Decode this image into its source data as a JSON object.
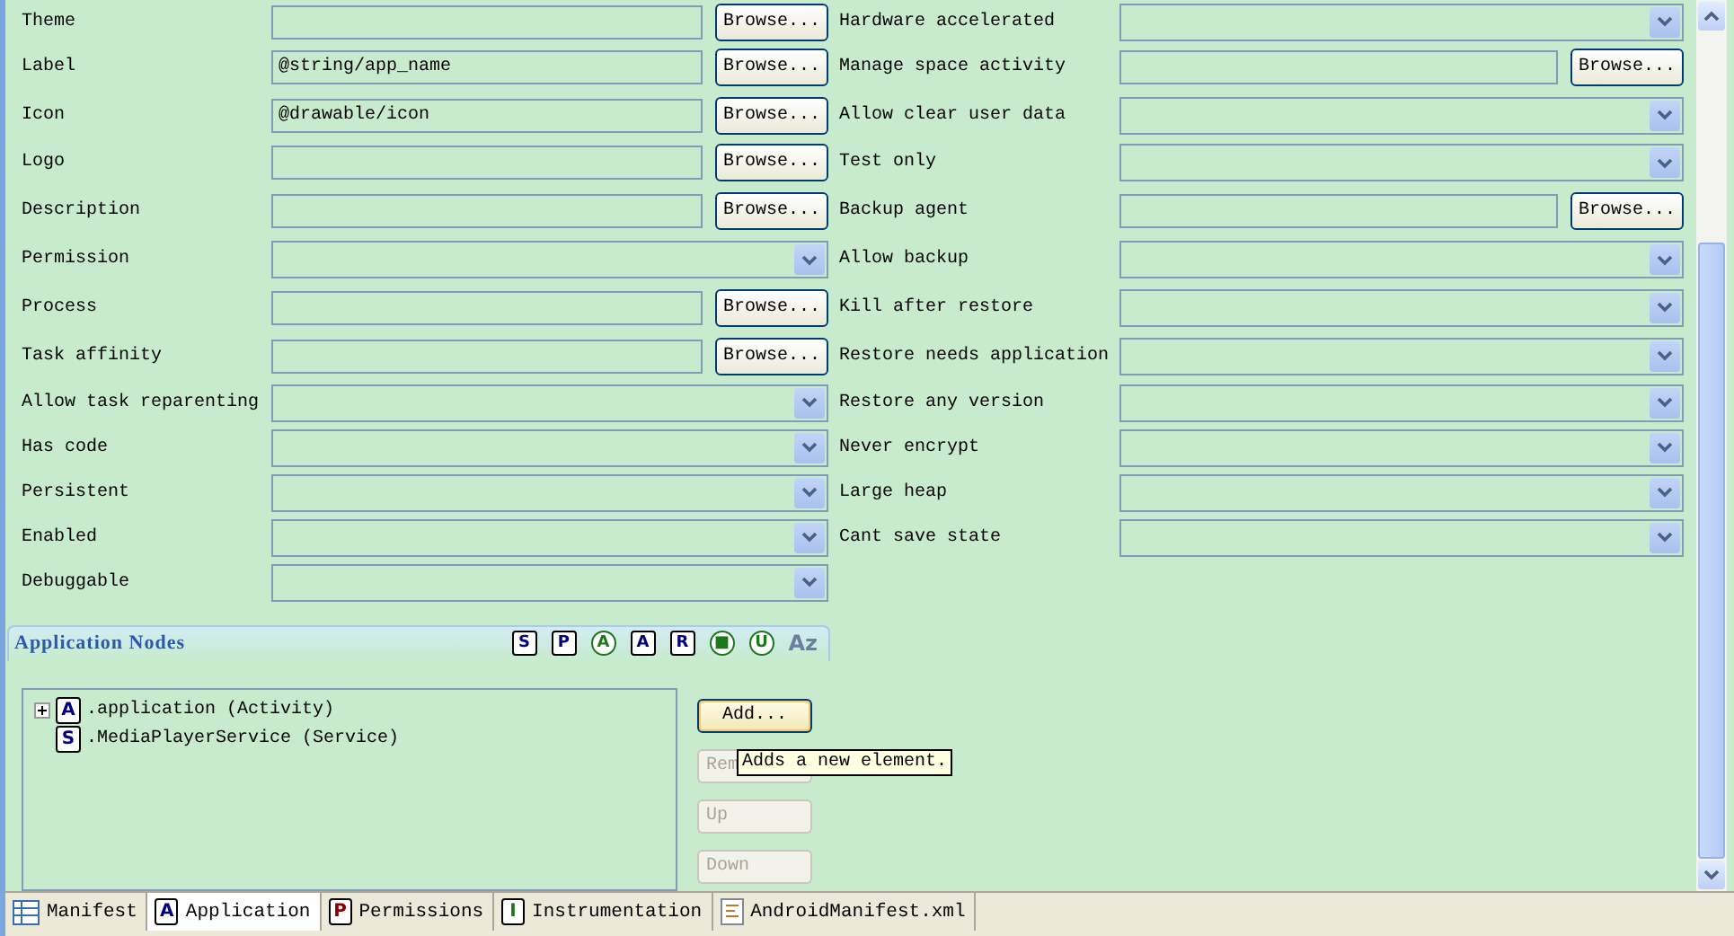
{
  "left_fields": [
    {
      "label": "Theme",
      "kind": "text",
      "browse": "Browse..."
    },
    {
      "label": "Label",
      "kind": "text",
      "value": "@string/app_name",
      "browse": "Browse..."
    },
    {
      "label": "Icon",
      "kind": "text",
      "value": "@drawable/icon",
      "browse": "Browse..."
    },
    {
      "label": "Logo",
      "kind": "text",
      "browse": "Browse..."
    },
    {
      "label": "Description",
      "kind": "text",
      "browse": "Browse..."
    },
    {
      "label": "Permission",
      "kind": "combo"
    },
    {
      "label": "Process",
      "kind": "text",
      "browse": "Browse..."
    },
    {
      "label": "Task affinity",
      "kind": "text",
      "browse": "Browse..."
    },
    {
      "label": "Allow task reparenting",
      "kind": "combo"
    },
    {
      "label": "Has code",
      "kind": "combo"
    },
    {
      "label": "Persistent",
      "kind": "combo"
    },
    {
      "label": "Enabled",
      "kind": "combo"
    },
    {
      "label": "Debuggable",
      "kind": "combo"
    }
  ],
  "right_fields": [
    {
      "label": "Hardware accelerated",
      "kind": "combo"
    },
    {
      "label": "Manage space activity",
      "kind": "text",
      "browse": "Browse..."
    },
    {
      "label": "Allow clear user data",
      "kind": "combo"
    },
    {
      "label": "Test only",
      "kind": "combo"
    },
    {
      "label": "Backup agent",
      "kind": "text",
      "browse": "Browse..."
    },
    {
      "label": "Allow backup",
      "kind": "combo"
    },
    {
      "label": "Kill after restore",
      "kind": "combo"
    },
    {
      "label": "Restore needs application",
      "kind": "combo"
    },
    {
      "label": "Restore any version",
      "kind": "combo"
    },
    {
      "label": "Never encrypt",
      "kind": "combo"
    },
    {
      "label": "Large heap",
      "kind": "combo"
    },
    {
      "label": "Cant save state",
      "kind": "combo"
    }
  ],
  "nodes": {
    "title": "Application Nodes",
    "toolbar": [
      {
        "glyph": "S",
        "kind": "box",
        "color": "#000080"
      },
      {
        "glyph": "P",
        "kind": "box",
        "color": "#000080"
      },
      {
        "glyph": "A",
        "kind": "circle",
        "color": "#1a7a1a"
      },
      {
        "glyph": "A",
        "kind": "box",
        "color": "#000080"
      },
      {
        "glyph": "R",
        "kind": "box",
        "color": "#000080"
      },
      {
        "glyph": "■",
        "kind": "circle",
        "color": "#1a7a1a"
      },
      {
        "glyph": "U",
        "kind": "circle",
        "color": "#1a7a1a"
      },
      {
        "glyph": "Az",
        "kind": "plain",
        "color": "#6a7fa0"
      }
    ],
    "tree": [
      {
        "glyph": "A",
        "label": ".application (Activity)",
        "expanded": false
      },
      {
        "glyph": "S",
        "label": ".MediaPlayerService (Service)"
      }
    ],
    "buttons": [
      {
        "label": "Add...",
        "disabled": false,
        "focused": true
      },
      {
        "label": "Rem",
        "disabled": true,
        "focused": false
      },
      {
        "label": "Up",
        "disabled": true,
        "focused": false
      },
      {
        "label": "Down",
        "disabled": true,
        "focused": false
      }
    ],
    "tooltip": "Adds a new element."
  },
  "tabs": [
    {
      "label": "Manifest",
      "kind": "table",
      "selected": false
    },
    {
      "label": "Application",
      "kind": "letter",
      "glyph": "A",
      "color": "#000080",
      "selected": true
    },
    {
      "label": "Permissions",
      "kind": "letter",
      "glyph": "P",
      "color": "#8a0000",
      "selected": false
    },
    {
      "label": "Instrumentation",
      "kind": "letter",
      "glyph": "I",
      "color": "#1a7a1a",
      "selected": false
    },
    {
      "label": "AndroidManifest.xml",
      "kind": "file",
      "selected": false
    }
  ]
}
